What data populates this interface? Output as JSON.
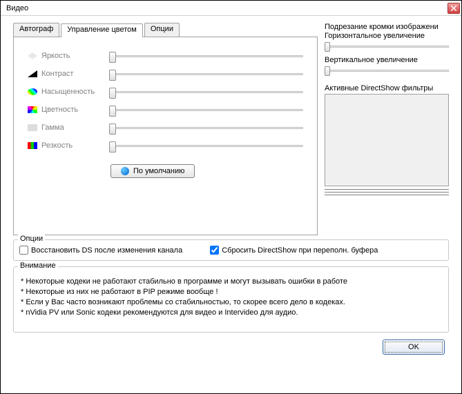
{
  "window": {
    "title": "Видео"
  },
  "tabs": [
    {
      "label": "Автограф",
      "active": false
    },
    {
      "label": "Управление цветом",
      "active": true
    },
    {
      "label": "Опции",
      "active": false
    }
  ],
  "sliders": [
    {
      "label": "Яркость",
      "icon": "ico-brightness"
    },
    {
      "label": "Контраст",
      "icon": "ico-contrast"
    },
    {
      "label": "Насыщенность",
      "icon": "ico-sat"
    },
    {
      "label": "Цветность",
      "icon": "ico-hue"
    },
    {
      "label": "Гамма",
      "icon": "ico-gamma"
    },
    {
      "label": "Резкость",
      "icon": "ico-sharp"
    }
  ],
  "default_btn": "По умолчанию",
  "right": {
    "crop": "Подрезание кромки изображени",
    "hzoom": "Горизонтальное увеличение",
    "vzoom": "Вертикальное увеличение",
    "filters": "Активные DirectShow фильтры"
  },
  "options": {
    "legend": "Опции",
    "restore_ds": "Восстановить DS после изменения канала",
    "reset_ds": "Сбросить DirectShow при переполн. буфера"
  },
  "warning": {
    "legend": "Внимание",
    "lines": [
      "*  Некоторые кодеки не работают стабильно в программе и могут вызывать ошибки в работе",
      "*  Некоторые из них не работают в PIP режиме вообще !",
      "*  Если у Вас часто возникают проблемы со стабильностью, то скорее всего дело в кодеках.",
      "*  nVidia PV или Sonic кодеки рекомендуются для видео и Intervideo для аудио."
    ]
  },
  "ok": "OK"
}
